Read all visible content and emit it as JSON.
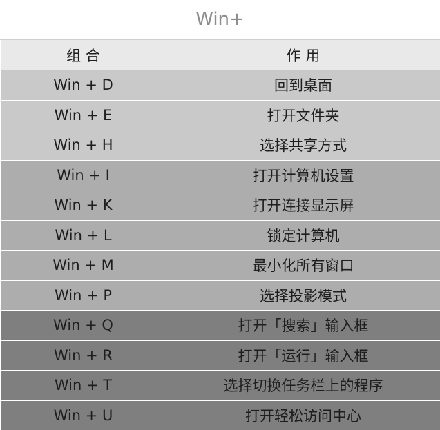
{
  "title": "Win+",
  "table": {
    "headers": [
      "组 合",
      "作 用"
    ],
    "rows": [
      {
        "combo": "Win + D",
        "action": "回到桌面",
        "group": 1
      },
      {
        "combo": "Win + E",
        "action": "打开文件夹",
        "group": 1
      },
      {
        "combo": "Win + H",
        "action": "选择共享方式",
        "group": 1
      },
      {
        "combo": "Win + I",
        "action": "打开计算机设置",
        "group": 2
      },
      {
        "combo": "Win + K",
        "action": "打开连接显示屏",
        "group": 2
      },
      {
        "combo": "Win + L",
        "action": "锁定计算机",
        "group": 2
      },
      {
        "combo": "Win + M",
        "action": "最小化所有窗口",
        "group": 2
      },
      {
        "combo": "Win + P",
        "action": "选择投影模式",
        "group": 2
      },
      {
        "combo": "Win + Q",
        "action": "打开「搜索」输入框",
        "group": 3
      },
      {
        "combo": "Win + R",
        "action": "打开「运行」输入框",
        "group": 3
      },
      {
        "combo": "Win + T",
        "action": "选择切换任务栏上的程序",
        "group": 3
      },
      {
        "combo": "Win + U",
        "action": "打开轻松访问中心",
        "group": 3
      }
    ]
  },
  "colors": {
    "group1": "#c9c9c9",
    "group2": "#adadad",
    "group3": "#7f7f7f",
    "header": "#e9e9e9",
    "title": "#8c8c8c"
  }
}
